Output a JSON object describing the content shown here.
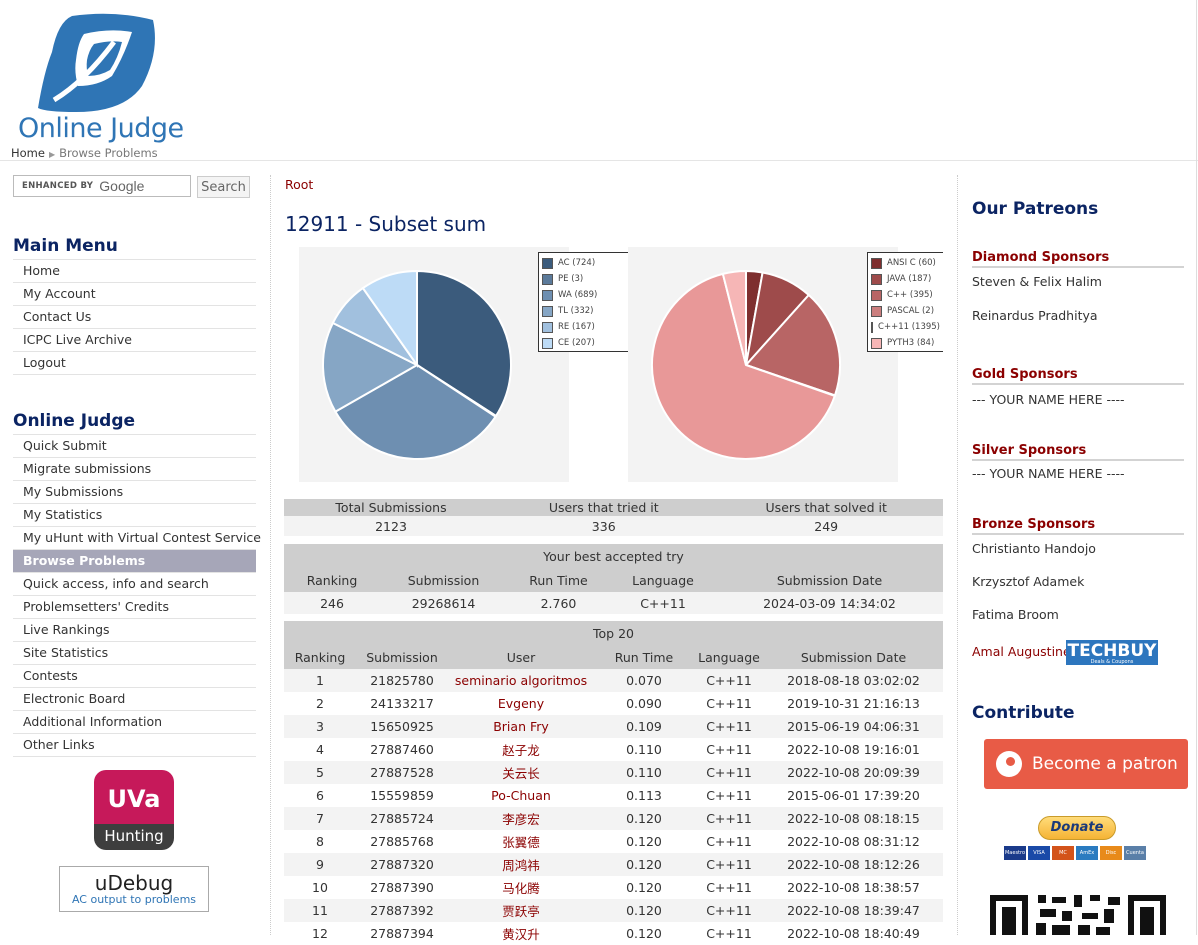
{
  "header": {
    "logo_text": "Online Judge",
    "breadcrumb": [
      "Home",
      "Browse Problems"
    ]
  },
  "search": {
    "brand_prefix": "ENHANCED BY",
    "brand": "Google",
    "button": "Search"
  },
  "main_menu": {
    "title": "Main Menu",
    "items": [
      "Home",
      "My Account",
      "Contact Us",
      "ICPC Live Archive",
      "Logout"
    ]
  },
  "oj_menu": {
    "title": "Online Judge",
    "active_index": 6,
    "items": [
      "Quick Submit",
      "Migrate submissions",
      "My Submissions",
      "My Statistics",
      "My uHunt with Virtual Contest Service",
      "Browse Problems",
      "Quick access, info and search",
      "Problemsetters' Credits",
      "Live Rankings",
      "Site Statistics",
      "Contests",
      "Electronic Board",
      "Additional Information",
      "Other Links"
    ]
  },
  "badges": {
    "uva_top": "UVa",
    "uva_bottom": "Hunting",
    "udebug_name": "uDebug",
    "udebug_sub": "AC output to problems"
  },
  "content": {
    "root_link": "Root",
    "problem_title": "12911 - Subset sum"
  },
  "verdict_chart": {
    "type": "pie",
    "legend": [
      "AC (724)",
      "PE (3)",
      "WA (689)",
      "TL (332)",
      "RE (167)",
      "CE (207)"
    ],
    "values": [
      724,
      3,
      689,
      332,
      167,
      207
    ],
    "colors": [
      "#3b5b7c",
      "#5b7a9a",
      "#6e8fb1",
      "#86a6c5",
      "#a1c0de",
      "#bddbf6"
    ]
  },
  "language_chart": {
    "type": "pie",
    "legend": [
      "ANSI C (60)",
      "JAVA (187)",
      "C++ (395)",
      "PASCAL (2)",
      "C++11 (1395)",
      "PYTH3 (84)"
    ],
    "values": [
      60,
      187,
      395,
      2,
      1395,
      84
    ],
    "colors": [
      "#7e2f2f",
      "#9e4b4b",
      "#b86565",
      "#cb7e7e",
      "#e89898",
      "#f6b6b6"
    ]
  },
  "chart_data": [
    {
      "type": "pie",
      "labels": [
        "AC",
        "PE",
        "WA",
        "TL",
        "RE",
        "CE"
      ],
      "values": [
        724,
        3,
        689,
        332,
        167,
        207
      ]
    },
    {
      "type": "pie",
      "labels": [
        "ANSI C",
        "JAVA",
        "C++",
        "PASCAL",
        "C++11",
        "PYTH3"
      ],
      "values": [
        60,
        187,
        395,
        2,
        1395,
        84
      ]
    }
  ],
  "stats": {
    "headers": [
      "Total Submissions",
      "Users that tried it",
      "Users that solved it"
    ],
    "values": [
      "2123",
      "336",
      "249"
    ]
  },
  "best_try": {
    "caption": "Your best accepted try",
    "headers": [
      "Ranking",
      "Submission",
      "Run Time",
      "Language",
      "Submission Date"
    ],
    "row": [
      "246",
      "29268614",
      "2.760",
      "C++11",
      "2024-03-09 14:34:02"
    ]
  },
  "top20": {
    "caption": "Top 20",
    "headers": [
      "Ranking",
      "Submission",
      "User",
      "Run Time",
      "Language",
      "Submission Date"
    ],
    "rows": [
      [
        "1",
        "21825780",
        "seminario algoritmos",
        "0.070",
        "C++11",
        "2018-08-18 03:02:02"
      ],
      [
        "2",
        "24133217",
        "Evgeny",
        "0.090",
        "C++11",
        "2019-10-31 21:16:13"
      ],
      [
        "3",
        "15650925",
        "Brian Fry",
        "0.109",
        "C++11",
        "2015-06-19 04:06:31"
      ],
      [
        "4",
        "27887460",
        "赵子龙",
        "0.110",
        "C++11",
        "2022-10-08 19:16:01"
      ],
      [
        "5",
        "27887528",
        "关云长",
        "0.110",
        "C++11",
        "2022-10-08 20:09:39"
      ],
      [
        "6",
        "15559859",
        "Po-Chuan",
        "0.113",
        "C++11",
        "2015-06-01 17:39:20"
      ],
      [
        "7",
        "27885724",
        "李彦宏",
        "0.120",
        "C++11",
        "2022-10-08 08:18:15"
      ],
      [
        "8",
        "27885768",
        "张翼德",
        "0.120",
        "C++11",
        "2022-10-08 08:31:12"
      ],
      [
        "9",
        "27887320",
        "周鸿祎",
        "0.120",
        "C++11",
        "2022-10-08 18:12:26"
      ],
      [
        "10",
        "27887390",
        "马化腾",
        "0.120",
        "C++11",
        "2022-10-08 18:38:57"
      ],
      [
        "11",
        "27887392",
        "贾跃亭",
        "0.120",
        "C++11",
        "2022-10-08 18:39:47"
      ],
      [
        "12",
        "27887394",
        "黄汉升",
        "0.120",
        "C++11",
        "2022-10-08 18:40:49"
      ]
    ]
  },
  "sidebar_right": {
    "patreons_title": "Our Patreons",
    "diamond_title": "Diamond Sponsors",
    "diamond": [
      "Steven & Felix Halim",
      "Reinardus Pradhitya"
    ],
    "gold_title": "Gold Sponsors",
    "gold": [
      "--- YOUR NAME HERE ----"
    ],
    "silver_title": "Silver Sponsors",
    "silver": [
      "--- YOUR NAME HERE ----"
    ],
    "bronze_title": "Bronze Sponsors",
    "bronze": [
      "Christianto Handojo",
      "Krzysztof Adamek",
      "Fatima Broom",
      "Amal Augustine"
    ],
    "techbuy": "TECHBUY",
    "techbuy_sub": "Deals & Coupons",
    "contribute_title": "Contribute",
    "patron_button": "Become a patron",
    "donate_button": "Donate",
    "cards": [
      "Maestro",
      "VISA",
      "MC",
      "AmEx",
      "Disc",
      "Cuenta bancaria"
    ]
  }
}
